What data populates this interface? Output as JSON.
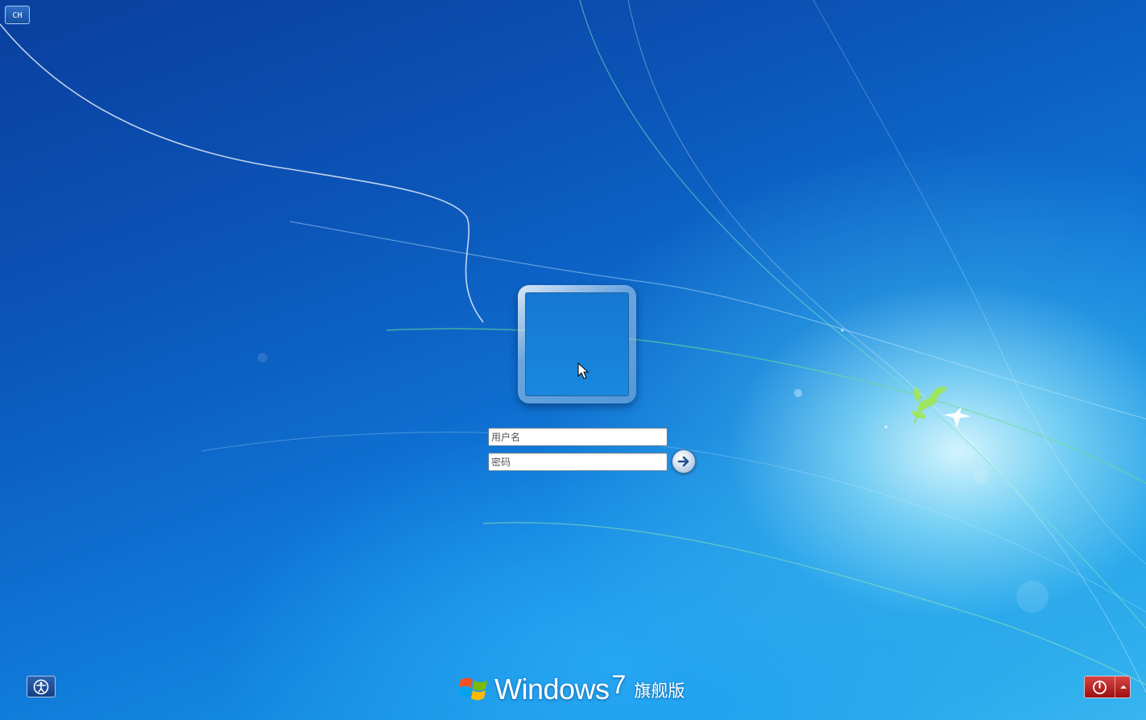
{
  "language_indicator": {
    "label": "CH",
    "icon": "language-bar"
  },
  "user_tile": {
    "icon": "user-picture-frame"
  },
  "login": {
    "username_placeholder": "用户名",
    "password_placeholder": "密码",
    "submit_icon": "arrow-right-icon"
  },
  "ease_of_access": {
    "icon": "ease-of-access-icon"
  },
  "branding": {
    "logo_icon": "windows-logo-icon",
    "product": "Windows",
    "version": "7",
    "edition": "旗舰版"
  },
  "shutdown": {
    "icon": "power-icon",
    "options_icon": "caret-up-icon"
  },
  "colors": {
    "background_dark": "#0a3f9e",
    "background_light": "#37b6f0",
    "shutdown_red": "#b51c1c"
  }
}
